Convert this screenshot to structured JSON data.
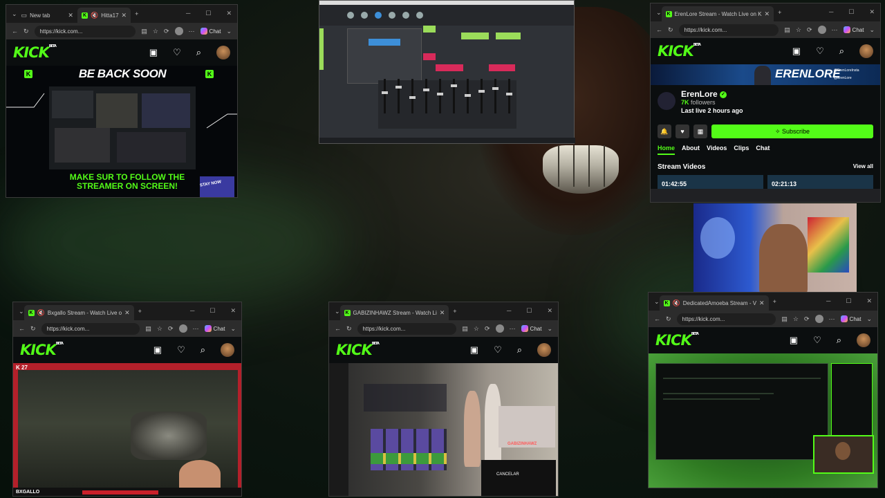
{
  "colors": {
    "kick_green": "#53fc18",
    "dark": "#0b0e0f",
    "browser_chrome": "#202124"
  },
  "windows": {
    "top_left": {
      "tabs": [
        {
          "label": "New tab"
        },
        {
          "label": "Hitta17"
        }
      ],
      "url": "https://kick.com...",
      "chat_label": "Chat",
      "overlay_top": "BE BACK SOON",
      "overlay_bottom": "MAKE SUR TO FOLLOW THE STREAMER ON SCREEN!",
      "overlay_corner": "STAY NOW"
    },
    "top_right": {
      "tab_label": "ErenLore Stream - Watch Live on K",
      "url": "https://kick.com...",
      "chat_label": "Chat",
      "banner_name": "ERENLORE",
      "banner_socials": [
        "@ErenLoreInsta",
        "@ErenLore"
      ],
      "channel_name": "ErenLore",
      "followers_count": "7K",
      "followers_label": "followers",
      "last_live": "Last live 2 hours ago",
      "subscribe_label": "Subscribe",
      "nav_tabs": [
        "Home",
        "About",
        "Videos",
        "Clips",
        "Chat"
      ],
      "section_title": "Stream Videos",
      "view_all": "View all",
      "video_durations": [
        "01:42:55",
        "02:21:13"
      ]
    },
    "bottom_left": {
      "tab_label": "Bxgallo Stream - Watch Live o",
      "url": "https://kick.com...",
      "chat_label": "Chat",
      "stream_counter": "27",
      "streamer_tag": "BXGALLO"
    },
    "bottom_middle": {
      "tab_label": "GABIZINHAWZ Stream - Watch Li",
      "url": "https://kick.com...",
      "chat_label": "Chat",
      "game_cancel": "CANCELAR",
      "streamer_tag": "GABIZINHAWZ"
    },
    "bottom_right": {
      "tab_label": "DedicatedAmoeba Stream - V",
      "url": "https://kick.com...",
      "chat_label": "Chat"
    }
  },
  "kick_logo": "KICK",
  "kick_beta": "BETA"
}
